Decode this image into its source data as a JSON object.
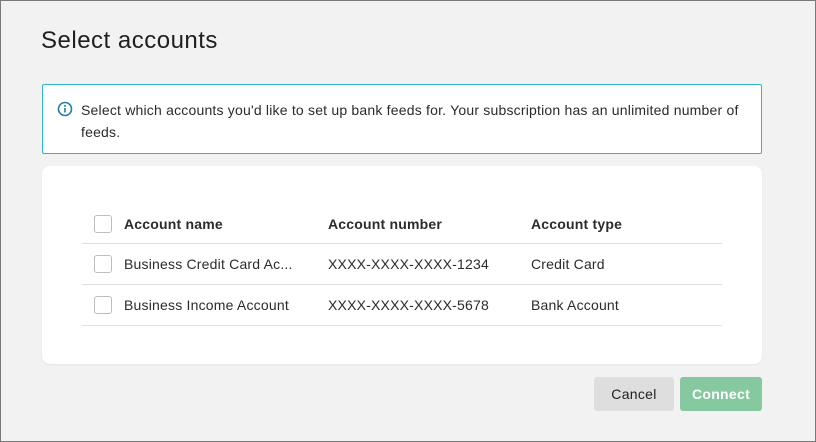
{
  "dialog": {
    "title": "Select accounts",
    "info_text": "Select which accounts you'd like to set up bank feeds for. Your subscription has an unlimited number of feeds.",
    "info_icon": "info-icon"
  },
  "table": {
    "headers": {
      "name": "Account name",
      "number": "Account number",
      "type": "Account type"
    },
    "rows": [
      {
        "name": "Business Credit Card Ac...",
        "number": "XXXX-XXXX-XXXX-1234",
        "type": "Credit Card",
        "checked": false
      },
      {
        "name": "Business Income Account",
        "number": "XXXX-XXXX-XXXX-5678",
        "type": "Bank Account",
        "checked": false
      }
    ]
  },
  "buttons": {
    "cancel": "Cancel",
    "connect": "Connect"
  },
  "colors": {
    "info_border": "#2fb3c6",
    "info_icon": "#1d7fa8",
    "connect_bg": "#86c9a0",
    "cancel_bg": "#dedede"
  }
}
